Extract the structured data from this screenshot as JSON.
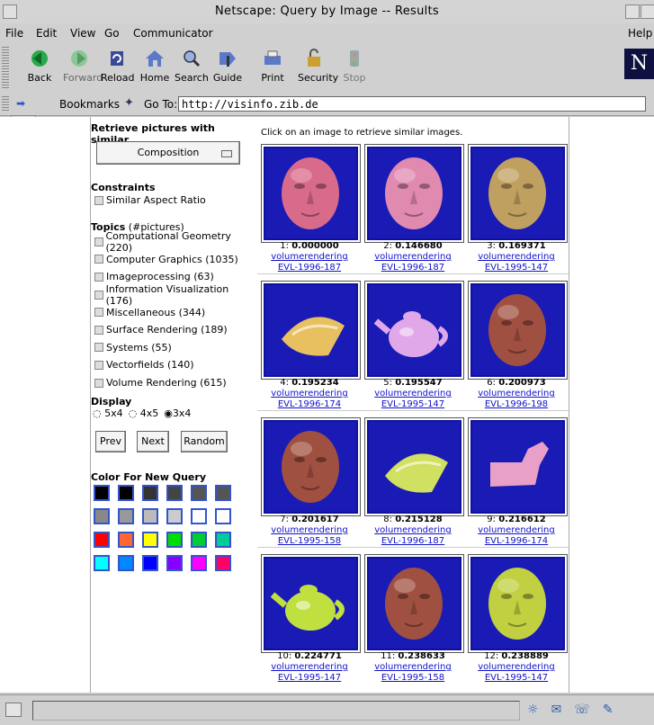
{
  "window": {
    "title": "Netscape: Query by Image -- Results"
  },
  "menu": [
    "File",
    "Edit",
    "View",
    "Go",
    "Communicator"
  ],
  "menu_help": "Help",
  "toolbar": [
    {
      "label": "Back",
      "icon": "back-arrow-icon"
    },
    {
      "label": "Forward",
      "icon": "forward-arrow-icon"
    },
    {
      "label": "Reload",
      "icon": "reload-icon"
    },
    {
      "label": "Home",
      "icon": "home-icon"
    },
    {
      "label": "Search",
      "icon": "search-icon"
    },
    {
      "label": "Guide",
      "icon": "guide-icon"
    },
    {
      "label": "Print",
      "icon": "print-icon"
    },
    {
      "label": "Security",
      "icon": "lock-icon"
    },
    {
      "label": "Stop",
      "icon": "stop-icon"
    }
  ],
  "location": {
    "bookmarks_label": "Bookmarks",
    "goto_label": "Go To:",
    "url": "http://visinfo.zib.de"
  },
  "left": {
    "heading": "Retrieve pictures with similar...",
    "mode": "Composition",
    "constraints_heading": "Constraints",
    "similar_aspect": "Similar Aspect Ratio",
    "topics_heading": "Topics",
    "topics_suffix": " (#pictures)",
    "topics": [
      "Computational Geometry (220)",
      "Computer Graphics (1035)",
      "Imageprocessing (63)",
      "Information Visualization (176)",
      "Miscellaneous (344)",
      "Surface Rendering (189)",
      "Systems (55)",
      "Vectorfields (140)",
      "Volume Rendering (615)"
    ],
    "display_heading": "Display",
    "display_options": [
      "5x4",
      "4x5",
      "3x4"
    ],
    "prev": "Prev",
    "next": "Next",
    "random": "Random",
    "color_heading": "Color For New Query",
    "colors": [
      "#000000",
      "#000000",
      "#333333",
      "#444444",
      "#555555",
      "#555555",
      "#888888",
      "#999999",
      "#bbbbbb",
      "#cccccc",
      "#ffffff",
      "#ffffff",
      "#ff0000",
      "#ff6633",
      "#ffff00",
      "#00dd00",
      "#00cc33",
      "#00cc99",
      "#00ffff",
      "#0088ff",
      "#0000ff",
      "#8800ff",
      "#ff00ff",
      "#ff0066"
    ]
  },
  "results": {
    "instruction": "Click on an image to retrieve similar images.",
    "items": [
      {
        "rank": "1:",
        "score": "0.000000",
        "kind": "volumerendering",
        "ref": "EVL-1996-187",
        "shape": "head",
        "color": "#d86a8a"
      },
      {
        "rank": "2:",
        "score": "0.146680",
        "kind": "volumerendering",
        "ref": "EVL-1996-187",
        "shape": "head",
        "color": "#e08ab0"
      },
      {
        "rank": "3:",
        "score": "0.169371",
        "kind": "volumerendering",
        "ref": "EVL-1995-147",
        "shape": "face",
        "color": "#c0a060"
      },
      {
        "rank": "4:",
        "score": "0.195234",
        "kind": "volumerendering",
        "ref": "EVL-1996-174",
        "shape": "cone",
        "color": "#e8c060"
      },
      {
        "rank": "5:",
        "score": "0.195547",
        "kind": "volumerendering",
        "ref": "EVL-1995-147",
        "shape": "teapot",
        "color": "#e0a8e8"
      },
      {
        "rank": "6:",
        "score": "0.200973",
        "kind": "volumerendering",
        "ref": "EVL-1996-198",
        "shape": "face",
        "color": "#a05040"
      },
      {
        "rank": "7:",
        "score": "0.201617",
        "kind": "volumerendering",
        "ref": "EVL-1995-158",
        "shape": "face",
        "color": "#a05040"
      },
      {
        "rank": "8:",
        "score": "0.215128",
        "kind": "volumerendering",
        "ref": "EVL-1996-187",
        "shape": "cone",
        "color": "#d0e060"
      },
      {
        "rank": "9:",
        "score": "0.216612",
        "kind": "volumerendering",
        "ref": "EVL-1996-174",
        "shape": "boot",
        "color": "#e8a0c8"
      },
      {
        "rank": "10:",
        "score": "0.224771",
        "kind": "volumerendering",
        "ref": "EVL-1995-147",
        "shape": "teapot",
        "color": "#c0e040"
      },
      {
        "rank": "11:",
        "score": "0.238633",
        "kind": "volumerendering",
        "ref": "EVL-1995-158",
        "shape": "face",
        "color": "#a05040"
      },
      {
        "rank": "12:",
        "score": "0.238889",
        "kind": "volumerendering",
        "ref": "EVL-1995-147",
        "shape": "face",
        "color": "#c0d040"
      }
    ]
  }
}
